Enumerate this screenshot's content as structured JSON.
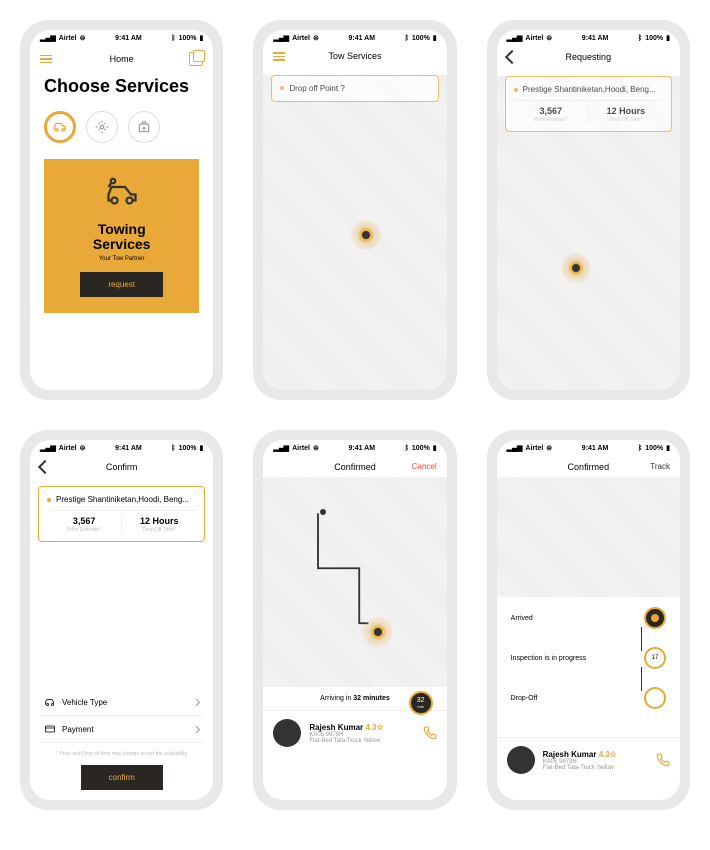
{
  "status": {
    "carrier": "Airtel",
    "time": "9:41 AM",
    "battery": "100%"
  },
  "s1": {
    "title": "Home",
    "heading": "Choose  Services",
    "card": {
      "title": "Towing\nServices",
      "sub": "Your Tow Partner",
      "btn": "request"
    }
  },
  "s2": {
    "title": "Tow Services",
    "placeholder": "Drop off Point ?"
  },
  "s3": {
    "title": "Requesting",
    "address": "Prestige Shantiniketan,Hoodi, Beng...",
    "price": "3,567",
    "priceLbl": "Price Estimate*",
    "time": "12 Hours",
    "timeLbl": "Drop Off Time*"
  },
  "s4": {
    "title": "Confirm",
    "address": "Prestige Shantiniketan,Hoodi, Beng...",
    "price": "3,567",
    "priceLbl": "Price Estimate*",
    "time": "12 Hours",
    "timeLbl": "Drop Off Time*",
    "opt1": "Vehicle Type",
    "opt2": "Payment",
    "fine": "* Price and Drop off time may change as per the availability",
    "btn": "confirm"
  },
  "s5": {
    "title": "Confirmed",
    "cancel": "Cancel",
    "arriving": "Arriving in",
    "eta": "32 minutes",
    "badge": "32",
    "badgeUnit": "min",
    "driver": {
      "name": "Rajesh Kumar",
      "rating": "4.3☆",
      "plate": "KA05 9879H",
      "vehicle": "Flat-Bed Tata-Truck Yellow"
    }
  },
  "s6": {
    "title": "Confirmed",
    "track": "Track",
    "steps": {
      "s1": "Arrived",
      "s2": "Inspection is in progress",
      "s2val": "17",
      "s2unit": "min",
      "s3": "Drop-Off"
    },
    "driver": {
      "name": "Rajesh Kumar",
      "rating": "4.3☆",
      "plate": "KA05 9879H",
      "vehicle": "Flat-Bed Tata-Truck Yellow"
    }
  }
}
